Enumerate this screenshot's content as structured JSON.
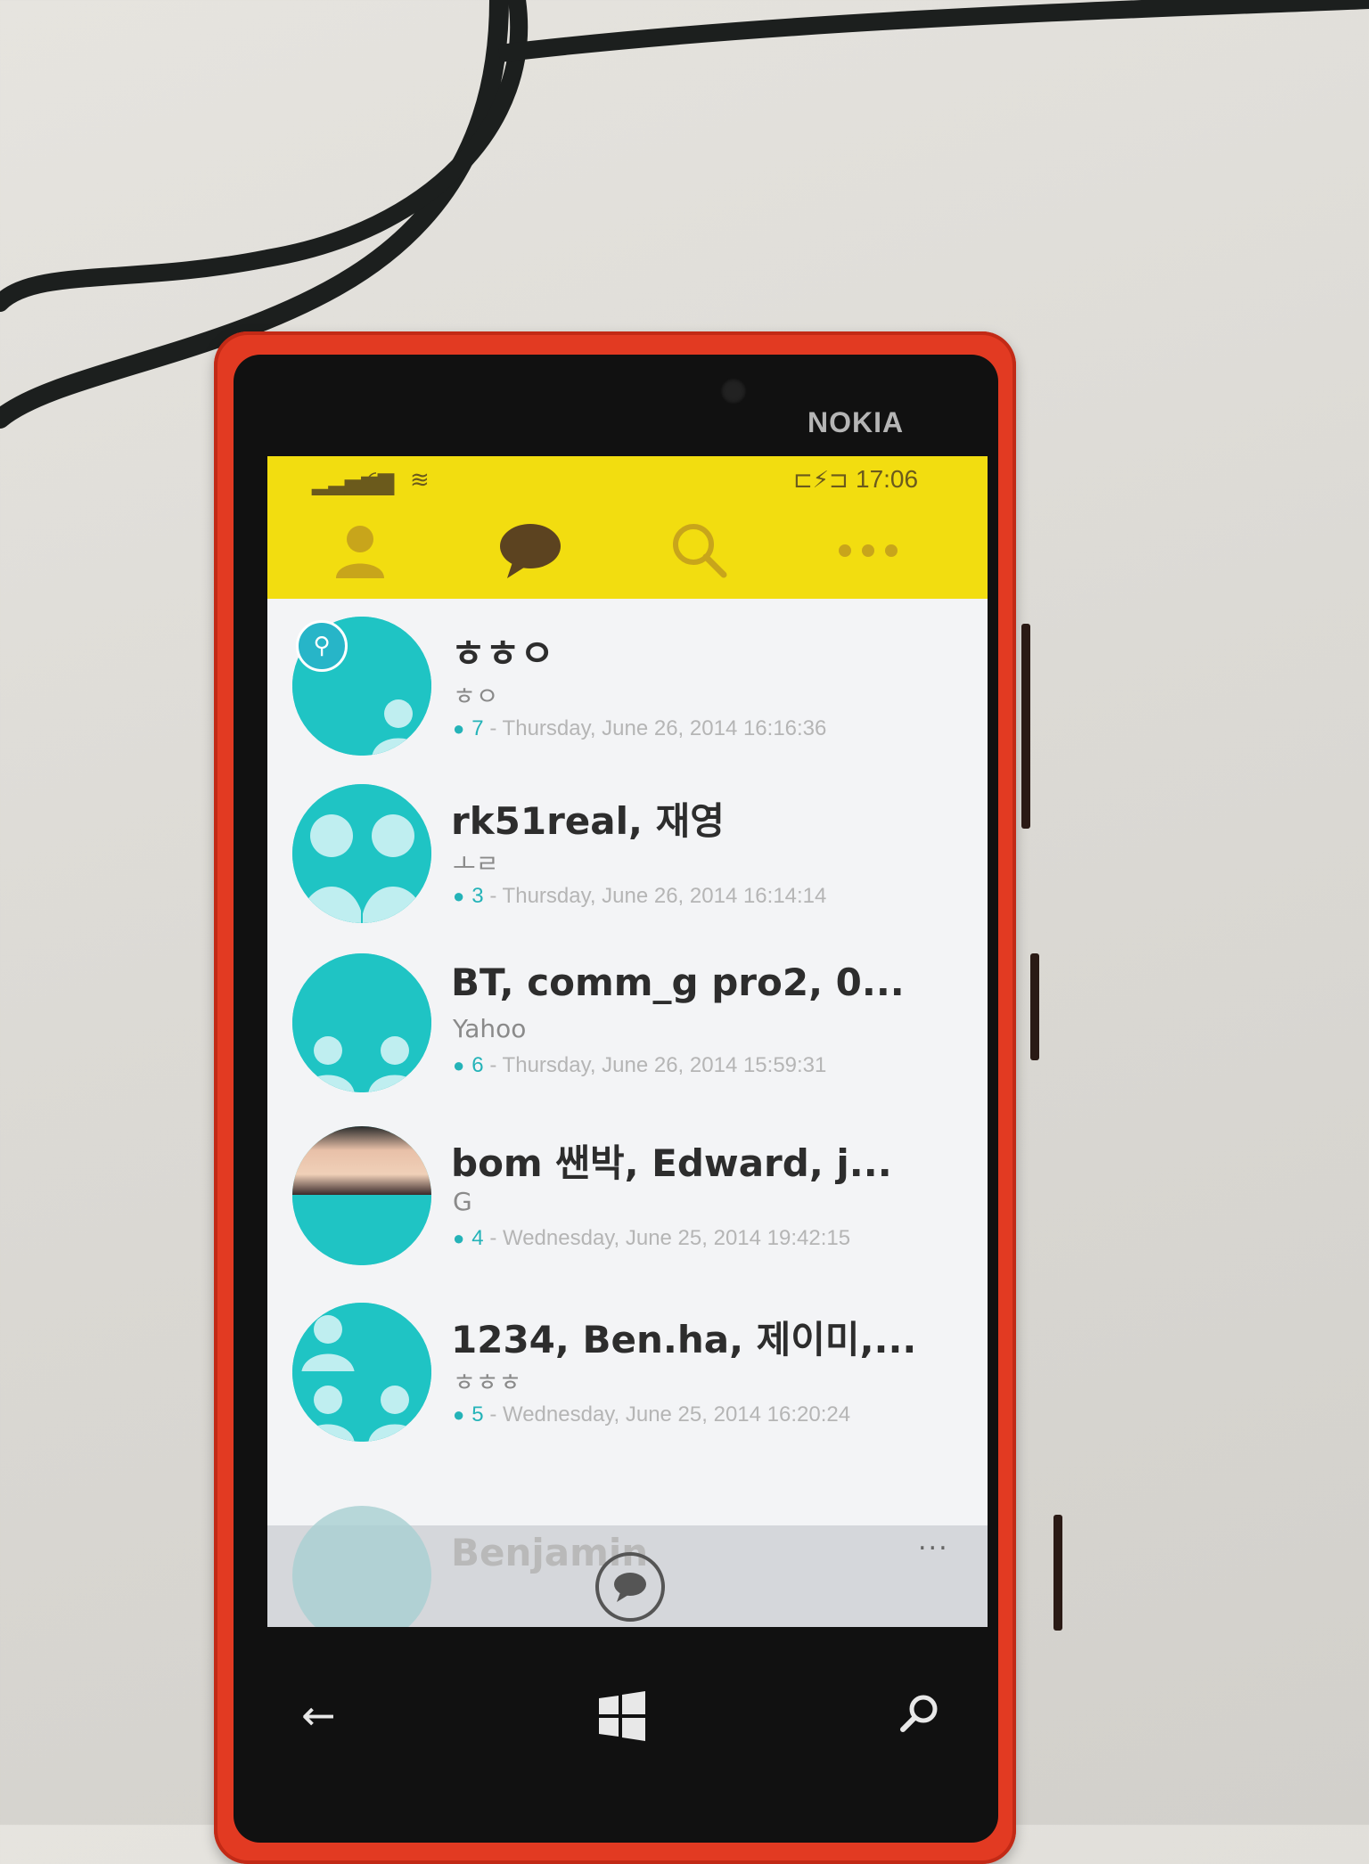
{
  "device": {
    "brand": "NOKIA"
  },
  "status_bar": {
    "time": "17:06"
  },
  "tabs": [
    {
      "name": "friends",
      "icon": "person-icon"
    },
    {
      "name": "chats",
      "icon": "chat-bubble-icon"
    },
    {
      "name": "search",
      "icon": "search-icon"
    },
    {
      "name": "more",
      "icon": "more-dots-icon"
    }
  ],
  "chats": [
    {
      "name": "ㅎㅎㅇ",
      "preview": "ㅎㅇ",
      "members": "7",
      "timestamp": "- Thursday, June 26, 2014 16:16:36",
      "pinned": true
    },
    {
      "name": "rk51real, 재영",
      "preview": "ㅗㄹ",
      "members": "3",
      "timestamp": "- Thursday, June 26, 2014 16:14:14"
    },
    {
      "name": "BT, comm_g pro2, 0...",
      "preview": "Yahoo",
      "members": "6",
      "timestamp": "- Thursday, June 26, 2014 15:59:31"
    },
    {
      "name": "bom 쌘박, Edward, j...",
      "preview": "G",
      "members": "4",
      "timestamp": "- Wednesday, June 25, 2014 19:42:15"
    },
    {
      "name": "1234, Ben.ha, 제이미,...",
      "preview": "ㅎㅎㅎ",
      "members": "5",
      "timestamp": "- Wednesday, June 25, 2014 16:20:24"
    }
  ],
  "peek_chat": {
    "name": "Benjamin"
  },
  "app_bar": {
    "more": "..."
  },
  "colors": {
    "accent_yellow": "#f2dd10",
    "teal": "#1fc4c4",
    "phone_red": "#e23a22"
  }
}
